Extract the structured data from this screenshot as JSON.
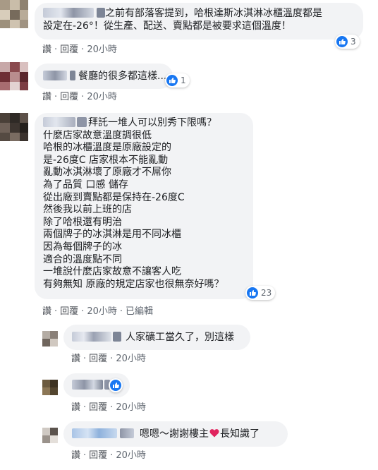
{
  "comments": [
    {
      "text_lines": [
        "之前有部落客提到，哈根達斯冰淇淋冰櫃溫度都是",
        "設定在-26°！從生產、配送、賣點都是被要求這個溫度！"
      ],
      "reactions": "3",
      "actions": {
        "like": "讚",
        "reply": "回覆",
        "time": "20小時"
      }
    },
    {
      "text_lines": [
        "餐廳的很多都這樣..."
      ],
      "reactions": "1",
      "actions": {
        "like": "讚",
        "reply": "回覆",
        "time": "20小時"
      }
    },
    {
      "text_lines": [
        "拜託一堆人可以別秀下限嗎？",
        "什麼店家故意溫度調很低",
        "哈根的冰櫃溫度是原廠設定的",
        "是-26度C 店家根本不能亂動",
        "亂動冰淇淋壞了原廠才不屌你",
        "為了品質 口感 儲存",
        "從出廠到賣點都是保持在-26度C",
        "然後我以前上班的店",
        "除了哈根還有明治",
        "兩個牌子的冰淇淋是用不同冰櫃",
        "因為每個牌子的冰",
        "適合的溫度點不同",
        "一堆說什麼店家故意不讓客人吃",
        "有夠無知 原廠的規定店家也很無奈好嗎？"
      ],
      "reactions": "23",
      "actions": {
        "like": "讚",
        "reply": "回覆",
        "time": "20小時",
        "edited": "已編輯"
      }
    }
  ],
  "replies": [
    {
      "text": "人家礦工當久了，別這樣",
      "actions": {
        "like": "讚",
        "reply": "回覆",
        "time": "20小時"
      }
    },
    {
      "text": "",
      "actions": {
        "like": "讚",
        "reply": "回覆",
        "time": "20小時"
      }
    },
    {
      "text_before": "嗯嗯～謝謝樓主",
      "text_after": "長知識了",
      "actions": {
        "like": "讚",
        "reply": "回覆",
        "time": "20小時"
      }
    }
  ],
  "colors": {
    "bubble": "#f2f3f5",
    "like_blue": "#1877f2",
    "meta": "#606770",
    "heart": "#e0245e"
  },
  "icons": {
    "reaction": "like-icon",
    "emoji": "heart-icon"
  }
}
